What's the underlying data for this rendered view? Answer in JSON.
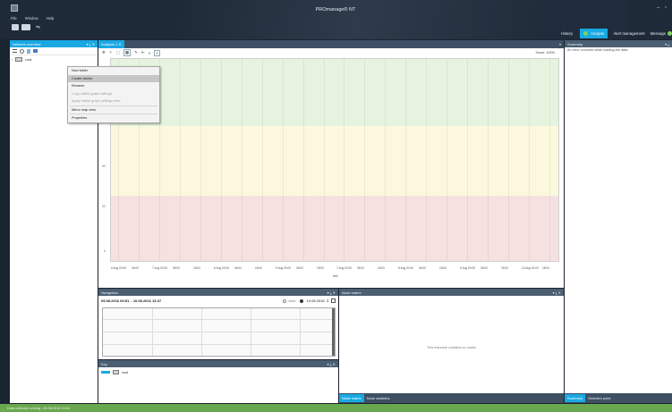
{
  "app": {
    "title": "PROmanage® NT"
  },
  "menu": [
    "File",
    "Window",
    "Help"
  ],
  "topnav": {
    "history": "History",
    "analyse": "Analyse",
    "alert": "Alert management",
    "message": "Message"
  },
  "network_overview": {
    "title": "Network overview",
    "tree_root": "root"
  },
  "context_menu": {
    "items": [
      {
        "label": "New folder",
        "state": "normal"
      },
      {
        "label": "Create device",
        "state": "highlight"
      },
      {
        "label": "Rename",
        "state": "normal"
      },
      {
        "label": "Copy visible graph settings",
        "state": "disabled"
      },
      {
        "label": "Apply visible graph settings here",
        "state": "disabled"
      },
      {
        "label": "Mirror map view",
        "state": "normal"
      },
      {
        "label": "Properties",
        "state": "normal"
      }
    ]
  },
  "analysis_tab": {
    "label": "Analysis 1",
    "zoom": "Zoom: 100%"
  },
  "chart_data": {
    "type": "line",
    "xlabel": "time",
    "ylabel": "",
    "y_tick_labels": [
      "50",
      "40",
      "20",
      "0"
    ],
    "x_tick_labels": [
      "6 Aug 00:00",
      "06:00",
      "7 Aug 00:00",
      "06:00",
      "18:00",
      "8 Aug 00:00",
      "06:00",
      "18:00",
      "9 Aug 00:00",
      "06:00",
      "18:00",
      "7 Aug 00:00",
      "06:00",
      "18:00",
      "8 Aug 00:00",
      "06:00",
      "18:00",
      "9 Aug 00:00",
      "06:00",
      "18:00",
      "10 Aug 00:00",
      "18:00"
    ],
    "bands": [
      {
        "name": "green",
        "color": "#e6f4df"
      },
      {
        "name": "yellow",
        "color": "#fbf8de"
      },
      {
        "name": "red",
        "color": "#f6e1e1"
      }
    ],
    "series": []
  },
  "navigation": {
    "title": "Navigation",
    "range_start": "05.08.2016 09:51",
    "range_end": "10.08.2016 13:37",
    "auto_label": "Auto",
    "date_value": "10.08.2016"
  },
  "key": {
    "title": "Key",
    "item": "root"
  },
  "node_matrix": {
    "title": "Node matrix",
    "empty": "This resource contains no nodes"
  },
  "bottom_tabs_mid": [
    "Node matrix",
    "Node statistics"
  ],
  "summary": {
    "title": "Summary",
    "message": "An error occurred while loading the data."
  },
  "bottom_tabs_right": [
    "Summary",
    "Selected point"
  ],
  "status": {
    "text": "Data collector running - 09.08.2016 13:44"
  },
  "colors": {
    "accent": "#19a9e2",
    "status": "#6aa84f",
    "panel_header": "#4b5f72"
  }
}
